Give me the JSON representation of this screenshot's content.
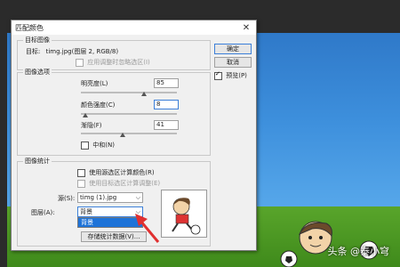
{
  "dialog": {
    "title": "匹配颜色",
    "close_glyph": "✕",
    "target_group": {
      "label": "目标图像",
      "target_label": "目标:",
      "target_value": "timg.jpg(图层 2, RGB/8)",
      "ignore_selection_label": "应用调整时忽略选区(I)"
    },
    "image_options": {
      "label": "图像选项",
      "luminance_label": "明亮度(L)",
      "luminance_value": "85",
      "color_intensity_label": "颜色强度(C)",
      "color_intensity_value": "8",
      "fade_label": "渐隐(F)",
      "fade_value": "41",
      "neutralize_label": "中和(N)"
    },
    "image_stats": {
      "label": "图像统计",
      "use_selection_source_label": "使用源选区计算颜色(R)",
      "use_selection_target_label": "使用目标选区计算调整(E)",
      "source_label": "源(S):",
      "source_value": "timg (1).jpg",
      "layer_label": "图层(A):",
      "layer_value": "背景",
      "layer_options": [
        "背景"
      ],
      "save_stats_label": "存储统计数据(V)..."
    },
    "buttons": {
      "ok": "确定",
      "cancel": "取消",
      "preview": "预览(P)"
    },
    "preview_checked": true
  },
  "watermark": "头条 @泰小穹",
  "colors": {
    "accent": "#1e73d8",
    "arrow": "#e03030",
    "sky": "#3d8fdc",
    "grass": "#4f9a25"
  },
  "icons": {
    "close": "close-icon",
    "dropdown": "chevron-down-icon"
  }
}
